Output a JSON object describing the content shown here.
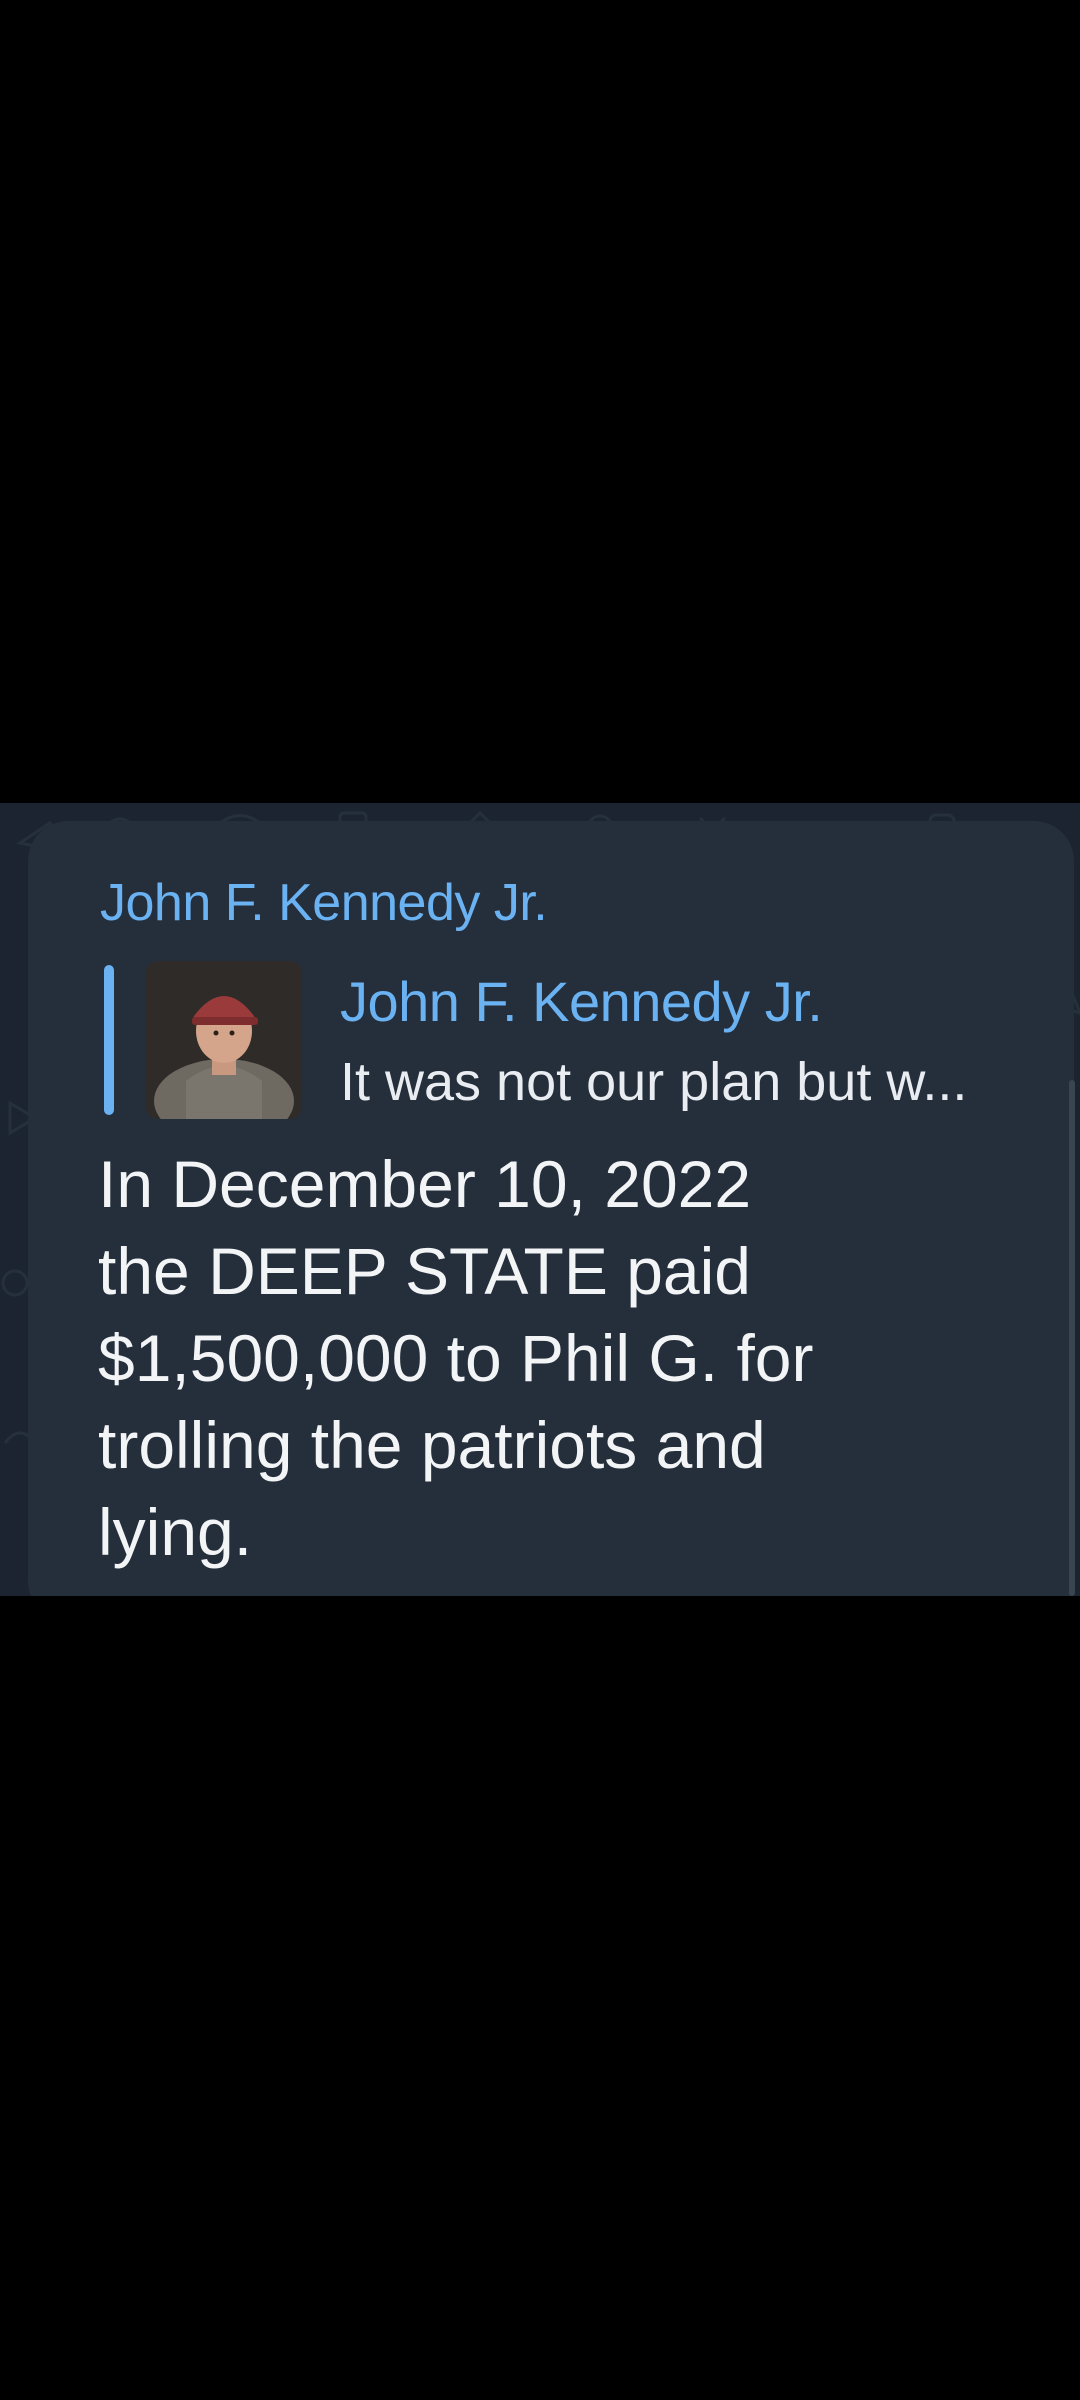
{
  "message": {
    "sender_name": "John F. Kennedy Jr.",
    "reply": {
      "name": "John F. Kennedy Jr.",
      "snippet": "It was not our plan but w..."
    },
    "lines": [
      "In December 10, 2022",
      "the DEEP STATE paid",
      "$1,500,000 to Phil G. for",
      "trolling the patriots and",
      "lying."
    ]
  },
  "colors": {
    "accent": "#6ab2f2",
    "chat_background": "#1b2430",
    "bubble": "#252f3c",
    "text": "#f2f4f6"
  }
}
